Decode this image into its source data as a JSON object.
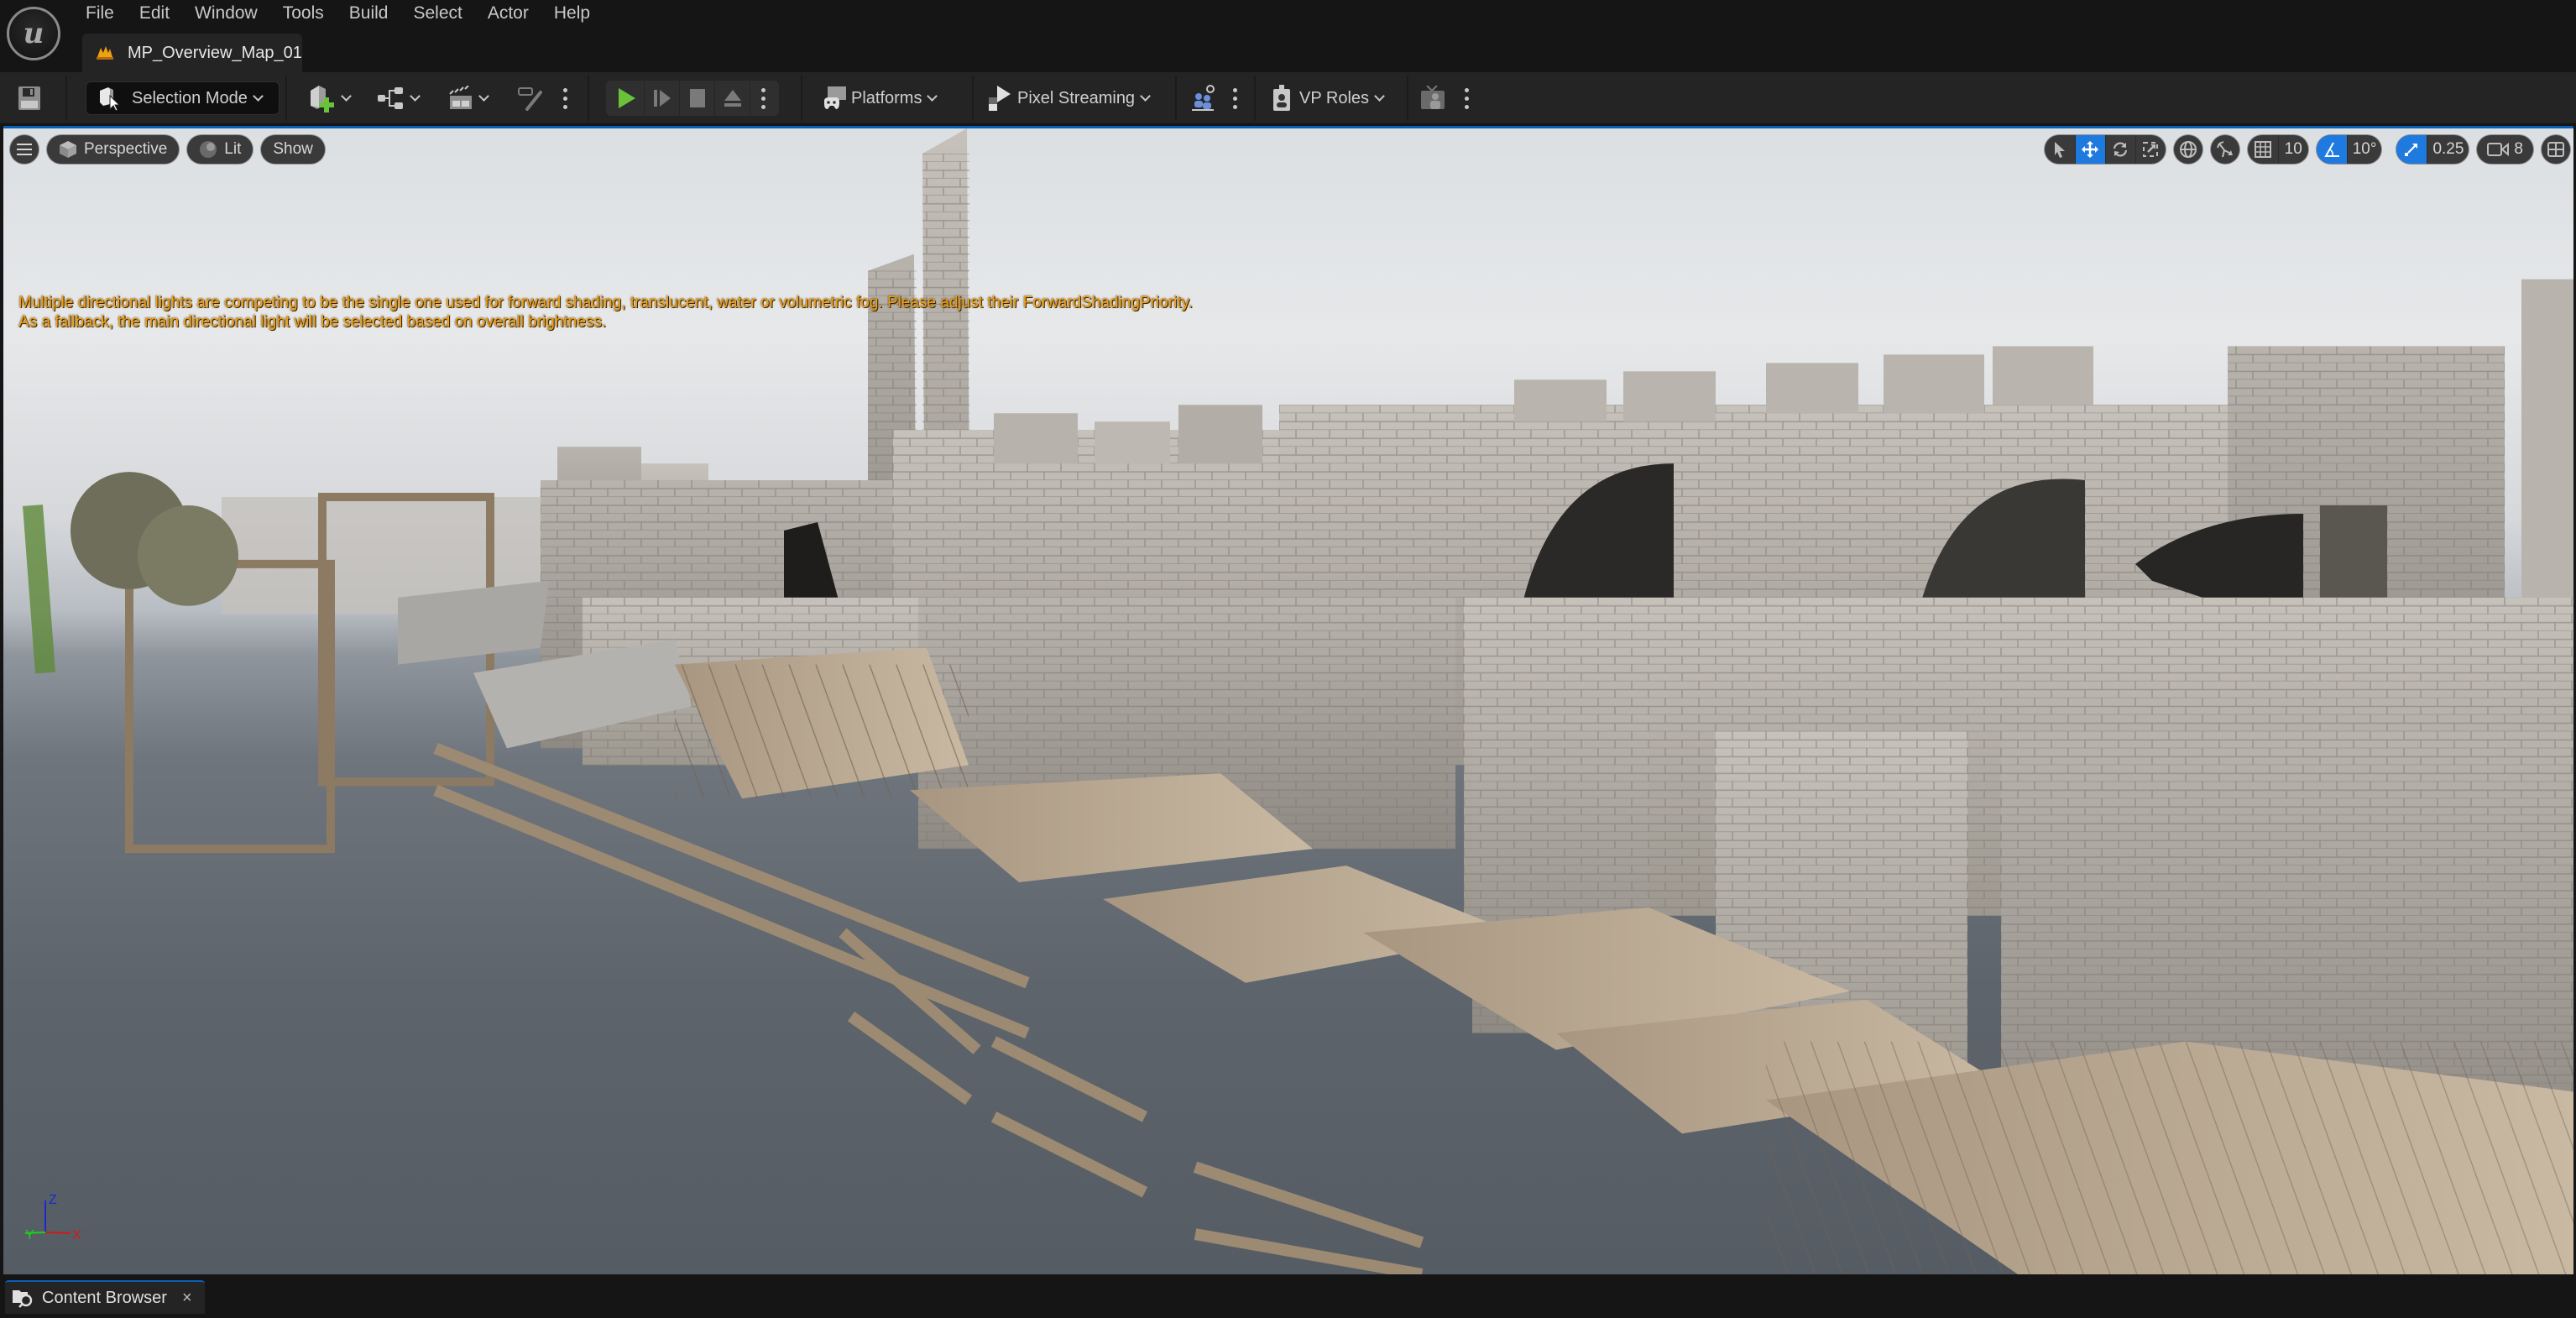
{
  "app": {
    "logo": "unreal-engine-logo",
    "menu": [
      "File",
      "Edit",
      "Window",
      "Tools",
      "Build",
      "Select",
      "Actor",
      "Help"
    ],
    "document_tab": {
      "label": "MP_Overview_Map_01",
      "icon": "level-icon"
    }
  },
  "toolbar": {
    "save_icon": "save-icon",
    "mode": {
      "label": "Selection Mode",
      "icon": "selection-mode-icon"
    },
    "create_buttons": [
      {
        "name": "quick-add",
        "icon": "add-actor-icon",
        "has_dropdown": true
      },
      {
        "name": "blueprints",
        "icon": "blueprint-icon",
        "has_dropdown": true
      },
      {
        "name": "cinematics",
        "icon": "clapperboard-icon",
        "has_dropdown": true
      },
      {
        "name": "modeling",
        "icon": "vr-brush-icon",
        "has_dropdown": false
      }
    ],
    "play_controls": [
      {
        "name": "play",
        "icon": "play-icon",
        "color": "#6ac23a"
      },
      {
        "name": "advance-frame",
        "icon": "step-icon"
      },
      {
        "name": "stop",
        "icon": "stop-icon"
      },
      {
        "name": "eject",
        "icon": "eject-icon"
      }
    ],
    "platforms_label": "Platforms",
    "pixel_streaming_label": "Pixel Streaming",
    "vp_roles_label": "VP Roles"
  },
  "viewport": {
    "top_left": {
      "menu_icon": "hamburger-icon",
      "view_mode": "Perspective",
      "lighting": "Lit",
      "show": "Show"
    },
    "top_right": {
      "transform_tools": [
        {
          "name": "select",
          "icon": "cursor-icon",
          "active": false
        },
        {
          "name": "translate",
          "icon": "move-icon",
          "active": true
        },
        {
          "name": "rotate",
          "icon": "rotate-icon",
          "active": false
        },
        {
          "name": "scale",
          "icon": "scale-icon",
          "active": false
        }
      ],
      "coordinate_space_icon": "globe-icon",
      "surface_snapping_icon": "surface-snap-icon",
      "grid_snap_value": "10",
      "rotation_snap_value": "10°",
      "scale_snap_value": "0.25",
      "camera_speed_value": "8",
      "layout_icon": "viewport-layout-icon"
    },
    "warning_lines": [
      "Multiple directional lights are competing to be the single one used for forward shading, translucent, water or volumetric fog. Please adjust their ForwardShadingPriority.",
      "As a fallback, the main directional light will be selected based on overall brightness."
    ],
    "axis": {
      "x": "X",
      "y": "Y",
      "z": "Z"
    },
    "accent_color": "#1f7ae0",
    "warning_color": "#f0a014"
  },
  "bottom": {
    "content_browser_tab": {
      "label": "Content Browser",
      "close": "×"
    }
  }
}
